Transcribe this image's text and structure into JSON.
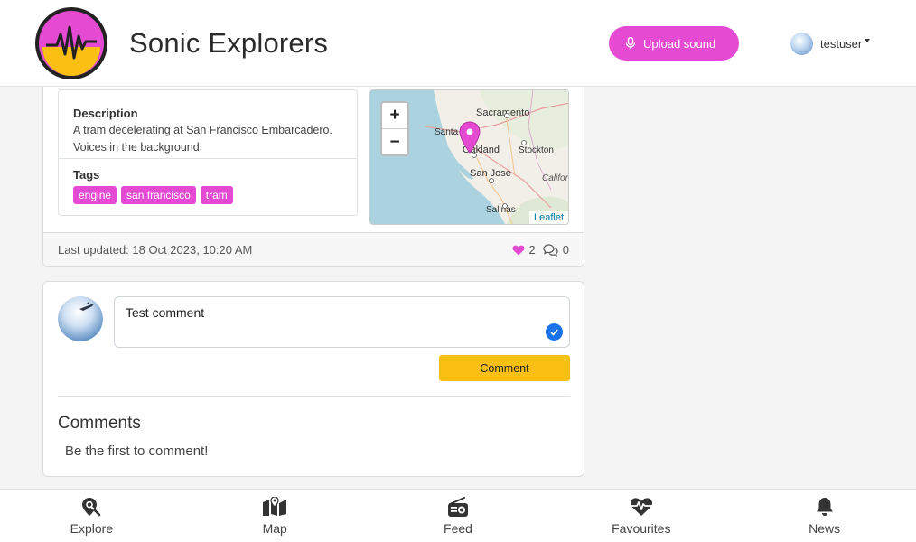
{
  "header": {
    "brand": "Sonic Explorers",
    "upload_label": "Upload sound",
    "username": "testuser"
  },
  "sound": {
    "description_label": "Description",
    "description": "A tram decelerating at San Francisco Embarcadero. Voices in the background.",
    "tags_label": "Tags",
    "tags": [
      "engine",
      "san francisco",
      "tram"
    ],
    "last_updated": "Last updated: 18 Oct 2023, 10:20 AM",
    "likes": "2",
    "comments_count": "0"
  },
  "map": {
    "zoom_in": "+",
    "zoom_out": "−",
    "attribution": "Leaflet",
    "places": [
      "Sacramento",
      "Oakland",
      "Santa",
      "Stockton",
      "San Jose",
      "Califor",
      "Salinas"
    ]
  },
  "comment_form": {
    "value": "Test comment",
    "button_label": "Comment"
  },
  "comments": {
    "title": "Comments",
    "empty_text": "Be the first to comment!"
  },
  "nav": [
    {
      "label": "Explore",
      "icon": "map-pin-icon"
    },
    {
      "label": "Map",
      "icon": "map-icon"
    },
    {
      "label": "Feed",
      "icon": "radio-icon"
    },
    {
      "label": "Favourites",
      "icon": "heart-pulse-icon"
    },
    {
      "label": "News",
      "icon": "bell-icon"
    }
  ],
  "colors": {
    "accent": "#e44ad2",
    "button_yellow": "#fbbf13"
  }
}
